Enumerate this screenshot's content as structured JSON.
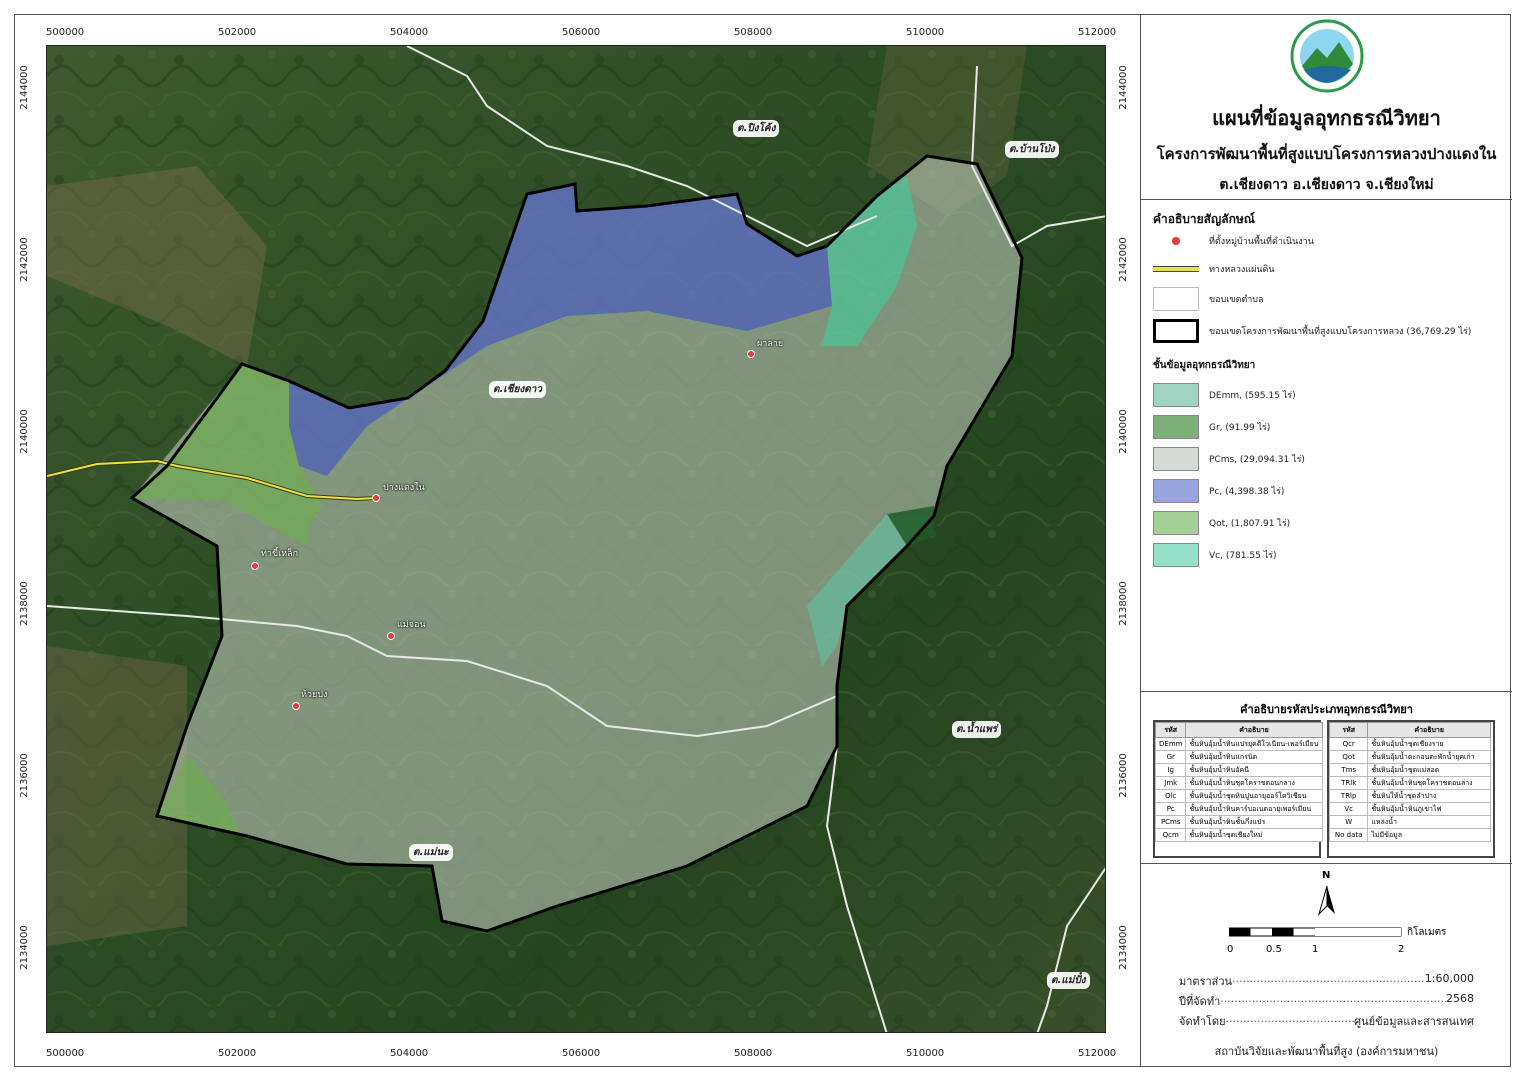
{
  "map": {
    "x_ticks": [
      "500000",
      "502000",
      "504000",
      "506000",
      "508000",
      "510000",
      "512000"
    ],
    "y_ticks": [
      "2144000",
      "2142000",
      "2140000",
      "2138000",
      "2136000",
      "2134000"
    ],
    "subdistricts": [
      "ต.ปิงโค้ง",
      "ต.บ้านโป่ง",
      "ต.เชียงดาว",
      "ต.น้ำแพร่",
      "ต.แม่นะ",
      "ต.แม่ปั๋ง"
    ],
    "villages": [
      "ผาลาย",
      "ปางแดงใน",
      "ท่าขี้เหล็ก",
      "แม่จอน",
      "ห้วยปง"
    ],
    "colors": {
      "DEmm": "#5fc6a8",
      "Gr": "#4a8a3a",
      "PCms": "#c8d2c4",
      "Pc": "#3d52c8",
      "Qot": "#6bb04a",
      "Vc": "#3fcf9e",
      "road": "#e8e24a",
      "boundary": "#000000",
      "tambon": "#e8e8e8"
    }
  },
  "panel": {
    "title": "แผนที่ข้อมูลอุทกธรณีวิทยา",
    "subtitle": "โครงการพัฒนาพื้นที่สูงแบบโครงการหลวงปางแดงใน",
    "location": "ต.เชียงดาว อ.เชียงดาว จ.เชียงใหม่",
    "legend_title": "คำอธิบายสัญลักษณ์",
    "legend_items": [
      "ที่ตั้งหมู่บ้านพื้นที่ดำเนินงาน",
      "ทางหลวงแผ่นดิน",
      "ขอบเขตตำบล",
      "ขอบเขตโครงการพัฒนาพื้นที่สูงแบบโครงการหลวง (36,769.29 ไร่)"
    ],
    "layer_title": "ชั้นข้อมูลอุทกธรณีวิทยา",
    "layers": [
      "DEmm, (595.15 ไร่)",
      "Gr, (91.99 ไร่)",
      "PCms, (29,094.31 ไร่)",
      "Pc, (4,398.38 ไร่)",
      "Qot, (1,807.91 ไร่)",
      "Vc, (781.55 ไร่)"
    ],
    "code_title": "คำอธิบายรหัสประเภทอุทกธรณีวิทยา",
    "code_head": [
      "รหัส",
      "คำอธิบาย"
    ],
    "codes_left": [
      [
        "DEmm",
        "ชั้นหินอุ้มน้ำหินแปรยุคดีโวเนียน-เพอร์เมียน"
      ],
      [
        "Gr",
        "ชั้นหินอุ้มน้ำหินแกรนิต"
      ],
      [
        "Ig",
        "ชั้นหินอุ้มน้ำหินอัคนี"
      ],
      [
        "Jmk",
        "ชั้นหินอุ้มน้ำหินชุดโคราชตอนกลาง"
      ],
      [
        "Olc",
        "ชั้นหินอุ้มน้ำชุดหินปูนอายุออร์โดวิเชียน"
      ],
      [
        "Pc",
        "ชั้นหินอุ้มน้ำหินคาร์บอเนตอายุเพอร์เมียน"
      ],
      [
        "PCms",
        "ชั้นหินอุ้มน้ำหินชั้นกึ่งแปร"
      ],
      [
        "Qcm",
        "ชั้นหินอุ้มน้ำชุดเชียงใหม่"
      ]
    ],
    "codes_right": [
      [
        "Qcr",
        "ชั้นหินอุ้มน้ำชุดเชียงราย"
      ],
      [
        "Qot",
        "ชั้นหินอุ้มน้ำตะกอนตะพักน้ำยุคเก่า"
      ],
      [
        "Tms",
        "ชั้นหินอุ้มน้ำชุดแม่สอด"
      ],
      [
        "TRlk",
        "ชั้นหินอุ้มน้ำหินชุดโคราชตอนล่าง"
      ],
      [
        "TRlp",
        "ชั้นหินให้น้ำชุดลำปาง"
      ],
      [
        "Vc",
        "ชั้นหินอุ้มน้ำหินภูเขาไฟ"
      ],
      [
        "W",
        "แหล่งน้ำ"
      ],
      [
        "No data",
        "ไม่มีข้อมูล"
      ]
    ],
    "north": "N",
    "scale_numbers": [
      "0",
      "0.5",
      "1",
      "2"
    ],
    "scale_unit": "กิโลเมตร",
    "info": [
      {
        "label": "มาตราส่วน",
        "value": "1:60,000"
      },
      {
        "label": "ปีที่จัดทำ",
        "value": "2568"
      },
      {
        "label": "จัดทำโดย",
        "value": "ศูนย์ข้อมูลและสารสนเทศ"
      }
    ],
    "footer": "สถาบันวิจัยและพัฒนาพื้นที่สูง (องค์การมหาชน)"
  }
}
